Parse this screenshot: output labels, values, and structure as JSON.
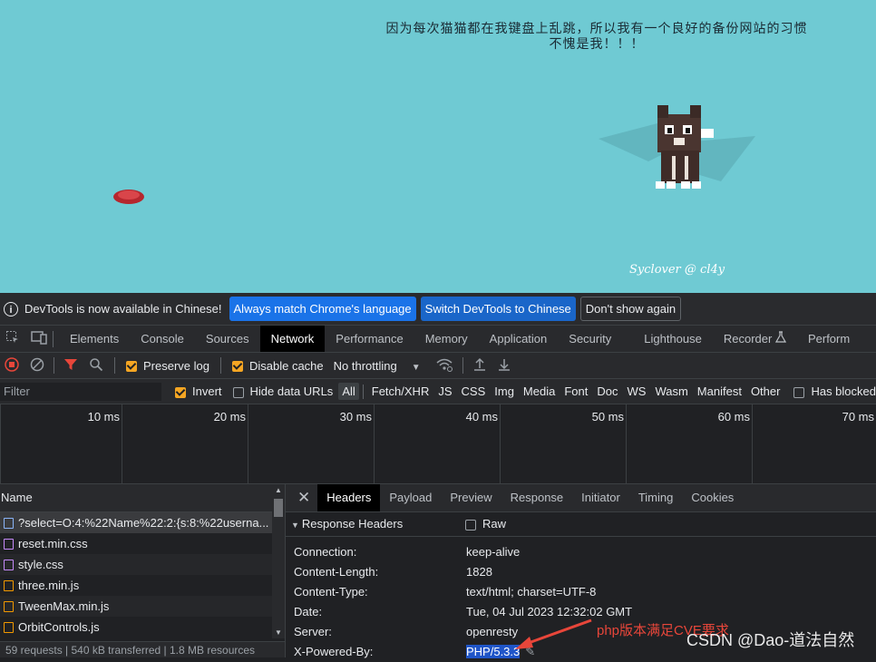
{
  "page": {
    "message_line1": "因为每次猫猫都在我键盘上乱跳，所以我有一个良好的备份网站的习惯",
    "message_line2": "不愧是我！！！",
    "signature": "Syclover @ cl4y"
  },
  "infobar": {
    "text": "DevTools is now available in Chinese!",
    "btn_match": "Always match Chrome's language",
    "btn_switch": "Switch DevTools to Chinese",
    "btn_dont": "Don't show again"
  },
  "tabs": [
    "Elements",
    "Console",
    "Sources",
    "Network",
    "Performance",
    "Memory",
    "Application",
    "Security",
    "Lighthouse",
    "Recorder",
    "Perform"
  ],
  "toolbar": {
    "preserve_log": "Preserve log",
    "disable_cache": "Disable cache",
    "throttling": "No throttling"
  },
  "filterbar": {
    "placeholder": "Filter",
    "invert": "Invert",
    "hide_data_urls": "Hide data URLs",
    "types": [
      "All",
      "Fetch/XHR",
      "JS",
      "CSS",
      "Img",
      "Media",
      "Font",
      "Doc",
      "WS",
      "Wasm",
      "Manifest",
      "Other"
    ],
    "has_blocked": "Has blocked"
  },
  "timeline": {
    "ticks": [
      "10 ms",
      "20 ms",
      "30 ms",
      "40 ms",
      "50 ms",
      "60 ms",
      "70 ms"
    ]
  },
  "requests": {
    "header": "Name",
    "rows": [
      {
        "name": "?select=O:4:%22Name%22:2:{s:8:%22userna...",
        "kind": "doc"
      },
      {
        "name": "reset.min.css",
        "kind": "css"
      },
      {
        "name": "style.css",
        "kind": "css"
      },
      {
        "name": "three.min.js",
        "kind": "js"
      },
      {
        "name": "TweenMax.min.js",
        "kind": "js"
      },
      {
        "name": "OrbitControls.js",
        "kind": "js"
      }
    ],
    "status": "59 requests | 540 kB transferred | 1.8 MB resources"
  },
  "detail": {
    "tabs": [
      "Headers",
      "Payload",
      "Preview",
      "Response",
      "Initiator",
      "Timing",
      "Cookies"
    ],
    "section": "Response Headers",
    "raw": "Raw",
    "headers": [
      {
        "key": "Connection:",
        "value": "keep-alive"
      },
      {
        "key": "Content-Length:",
        "value": "1828"
      },
      {
        "key": "Content-Type:",
        "value": "text/html; charset=UTF-8"
      },
      {
        "key": "Date:",
        "value": "Tue, 04 Jul 2023 12:32:02 GMT"
      },
      {
        "key": "Server:",
        "value": "openresty"
      },
      {
        "key": "X-Powered-By:",
        "value": "PHP/5.3.3"
      }
    ]
  },
  "annotation": "php版本满足CVE要求",
  "watermark": "CSDN @Dao-道法自然",
  "colors": {
    "page_bg": "#6fcad3",
    "accent_blue": "#1a73e8",
    "record_red": "#e8463a",
    "checkbox_orange": "#f5a623"
  }
}
